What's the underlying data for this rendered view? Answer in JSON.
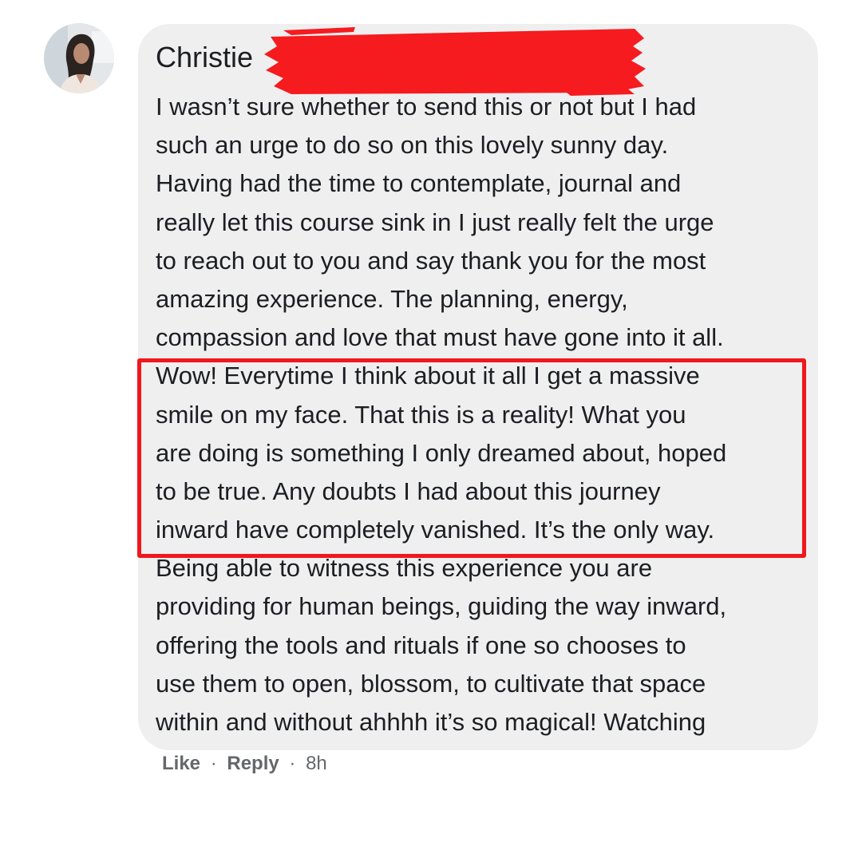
{
  "comment": {
    "author_name": "Christie",
    "text_lines": [
      "I wasn’t sure whether to send this or not but I had",
      "such an urge to do so on this lovely sunny day.",
      "Having had the time to contemplate, journal and",
      "really let this course sink in I just really felt the urge",
      "to reach out to you and say thank you for the most",
      "amazing experience. The planning, energy,",
      "compassion and love that must have gone into it all.",
      "Wow! Everytime I think about it all I get a massive",
      "smile on my face. That this is a reality! What you",
      "are doing is something I only dreamed about, hoped",
      "to be true. Any doubts I had about this journey",
      "inward have completely vanished. It’s the only way.",
      "Being able to witness this experience you are",
      "providing for human beings, guiding the way inward,",
      "offering the tools and rituals if one so chooses to",
      "use them to open, blossom, to cultivate that space",
      "within and without ahhhh it’s so magical! Watching"
    ],
    "actions": {
      "like_label": "Like",
      "reply_label": "Reply",
      "separator": "·",
      "timestamp": "8h"
    }
  },
  "colors": {
    "bubble_bg": "#efeff0",
    "text": "#1c1e21",
    "meta_text": "#65676b",
    "redaction": "#f51b1f",
    "highlight_border": "#f0171d"
  },
  "icons": {
    "avatar": "profile-photo-avatar",
    "redaction": "red-scribble-redaction"
  }
}
